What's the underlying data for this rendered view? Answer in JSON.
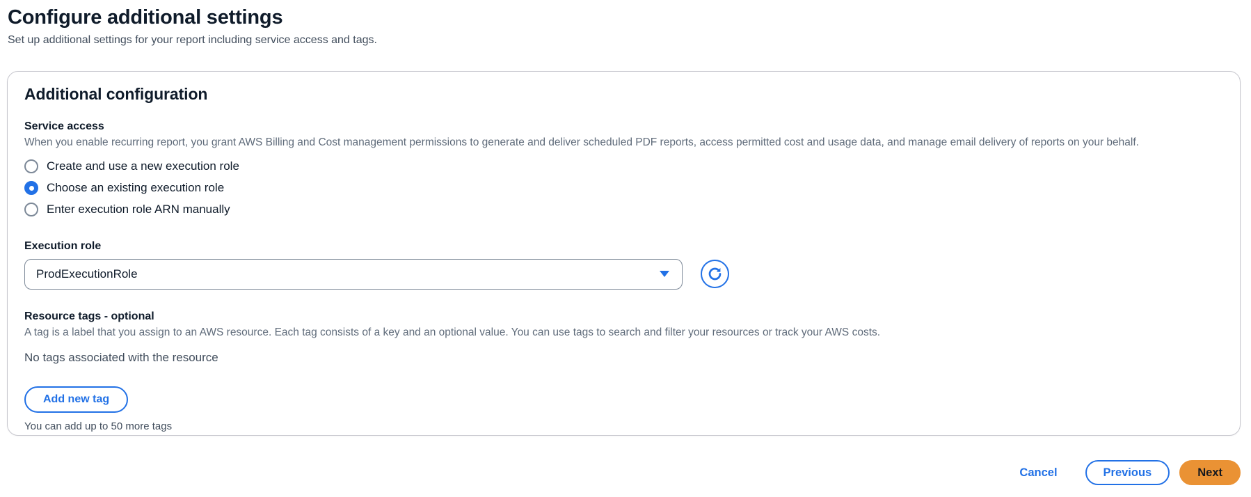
{
  "page": {
    "title": "Configure additional settings",
    "subtitle": "Set up additional settings for your report including service access and tags."
  },
  "card": {
    "title": "Additional configuration",
    "service_access": {
      "label": "Service access",
      "description": "When you enable recurring report, you grant AWS Billing and Cost management permissions to generate and deliver scheduled PDF reports, access permitted cost and usage data, and manage email delivery of reports on your behalf.",
      "options": [
        {
          "label": "Create and use a new execution role",
          "selected": false
        },
        {
          "label": "Choose an existing execution role",
          "selected": true
        },
        {
          "label": "Enter execution role ARN manually",
          "selected": false
        }
      ]
    },
    "execution_role": {
      "label": "Execution role",
      "value": "ProdExecutionRole",
      "icons": {
        "dropdown": "caret-down-icon",
        "refresh": "refresh-icon"
      }
    },
    "resource_tags": {
      "label": "Resource tags - optional",
      "description": "A tag is a label that you assign to an AWS resource. Each tag consists of a key and an optional value. You can use tags to search and filter your resources or track your AWS costs.",
      "empty_state": "No tags associated with the resource",
      "add_button_label": "Add new tag",
      "limit_note": "You can add up to 50 more tags"
    }
  },
  "footer": {
    "cancel_label": "Cancel",
    "previous_label": "Previous",
    "next_label": "Next"
  },
  "colors": {
    "accent_blue": "#2271e6",
    "primary_orange": "#ea9234",
    "secondary_text": "#5f6b7a",
    "card_border": "#c6c6cd"
  }
}
